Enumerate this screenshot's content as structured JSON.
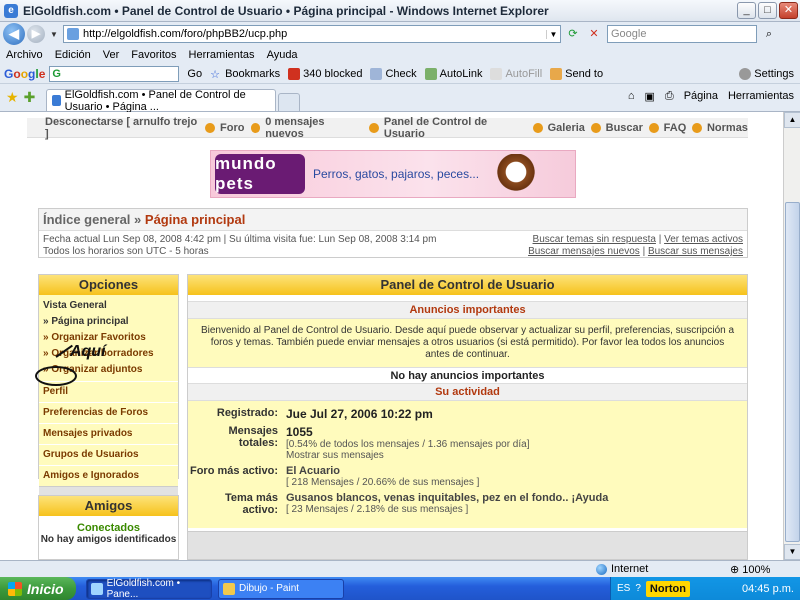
{
  "window": {
    "title": "ElGoldfish.com • Panel de Control de Usuario • Página principal - Windows Internet Explorer"
  },
  "address": {
    "url": "http://elgoldfish.com/foro/phpBB2/ucp.php",
    "search_placeholder": "Google"
  },
  "menu": [
    "Archivo",
    "Edición",
    "Ver",
    "Favoritos",
    "Herramientas",
    "Ayuda"
  ],
  "google_toolbar": {
    "logo": "Google",
    "search_value": "G",
    "go": "Go",
    "bookmarks": "Bookmarks",
    "blocked": "340 blocked",
    "check": "Check",
    "autolink": "AutoLink",
    "autofill": "AutoFill",
    "sendto": "Send to",
    "settings": "Settings"
  },
  "tab": {
    "label": "ElGoldfish.com • Panel de Control de Usuario • Página ...",
    "page": "Página",
    "tools": "Herramientas"
  },
  "forum_nav": {
    "logout": "Desconectarse [ arnulfo trejo ]",
    "forum": "Foro",
    "messages": "0 mensajes nuevos",
    "ucp": "Panel de Control de Usuario",
    "gallery": "Galeria",
    "search": "Buscar",
    "faq": "FAQ",
    "rules": "Normas"
  },
  "banner": {
    "logo": "mundo pets",
    "tagline": "Perros, gatos, pajaros, peces..."
  },
  "breadcrumb": {
    "index": "Índice general",
    "sep": "»",
    "current": "Página principal",
    "date_line": "Fecha actual Lun Sep 08, 2008 4:42 pm | Su última visita fue: Lun Sep 08, 2008 3:14 pm",
    "timezone": "Todos los horarios son UTC - 5 horas",
    "links": [
      "Buscar temas sin respuesta",
      "Ver temas activos",
      "Buscar mensajes nuevos",
      "Buscar sus mensajes"
    ]
  },
  "options": {
    "heading": "Opciones",
    "overview": "Vista General",
    "items": [
      "» Página principal",
      "» Organizar Favoritos",
      "» Organizar borradores",
      "» Organizar adjuntos"
    ],
    "sections": [
      "Perfil",
      "Preferencias de Foros",
      "Mensajes privados",
      "Grupos de Usuarios",
      "Amigos e Ignorados"
    ]
  },
  "annotation": {
    "text": "Aquí"
  },
  "friends": {
    "heading": "Amigos",
    "online": "Conectados",
    "none": "No hay amigos identificados"
  },
  "main": {
    "heading": "Panel de Control de Usuario",
    "announcements_title": "Anuncios importantes",
    "welcome": "Bienvenido al Panel de Control de Usuario. Desde aquí puede observar y actualizar su perfil, preferencias, suscripción a foros y temas. También puede enviar mensajes a otros usuarios (si está permitido). Por favor lea todos los anuncios antes de continuar.",
    "no_announcements": "No hay anuncios importantes",
    "activity_title": "Su actividad",
    "activity": {
      "registered_label": "Registrado:",
      "registered": "Jue Jul 27, 2006 10:22 pm",
      "total_label": "Mensajes totales:",
      "total": "1055",
      "total_sub": "[0.54% de todos los mensajes / 1.36 mensajes por día]",
      "total_link": "Mostrar sus mensajes",
      "forum_label": "Foro más activo:",
      "forum": "El Acuario",
      "forum_sub": "[ 218 Mensajes / 20.66% de sus mensajes ]",
      "topic_label": "Tema más activo:",
      "topic": "Gusanos blancos, venas inquitables, pez en el fondo.. ¡Ayuda",
      "topic_sub": "[ 23 Mensajes / 2.18% de sus mensajes ]"
    }
  },
  "status": {
    "zone": "Internet",
    "zoom": "100%"
  },
  "taskbar": {
    "start": "Inicio",
    "items": [
      "ElGoldfish.com • Pane...",
      "Dibujo - Paint"
    ],
    "lang": "ES",
    "norton": "Norton",
    "clock": "04:45 p.m."
  },
  "colors": {
    "accent": "#b2390f",
    "panel_yellow": "#fffbbd",
    "header_gold": "#f6c21c"
  }
}
